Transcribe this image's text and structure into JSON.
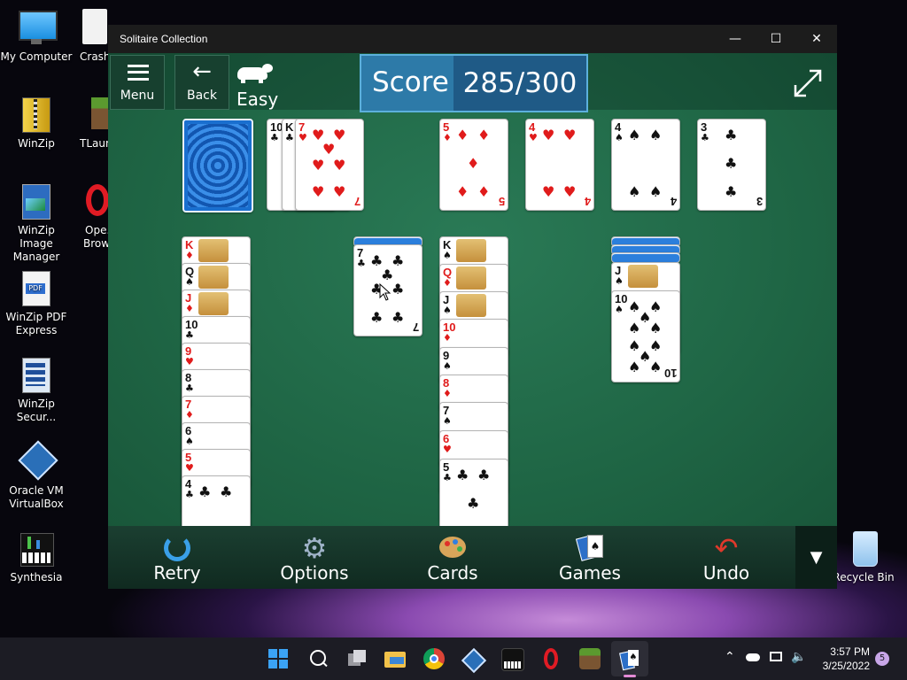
{
  "desktop": {
    "icons": [
      {
        "label": "My Computer"
      },
      {
        "label": "Crash..."
      },
      {
        "label": "WinZip"
      },
      {
        "label": "TLaun..."
      },
      {
        "label": "WinZip Image Manager"
      },
      {
        "label": "Ope... Brow..."
      },
      {
        "label": "WinZip PDF Express"
      },
      {
        "label": "WinZip Secur..."
      },
      {
        "label": "Oracle VM VirtualBox"
      },
      {
        "label": "Synthesia"
      },
      {
        "label": "Recycle Bin"
      }
    ]
  },
  "window": {
    "title": "Solitaire Collection",
    "minimize": "—",
    "maximize": "☐",
    "close": "✕"
  },
  "toolbar": {
    "menu_label": "Menu",
    "back_label": "Back",
    "difficulty": "Easy",
    "score_label": "Score",
    "score_value": "285/300"
  },
  "cards": {
    "waste": [
      {
        "rank": "10",
        "suit": "♣"
      },
      {
        "rank": "K",
        "suit": "♣"
      },
      {
        "rank": "7",
        "suit": "♥"
      }
    ],
    "foundations": [
      {
        "rank": "5",
        "suit": "♦"
      },
      {
        "rank": "4",
        "suit": "♥"
      },
      {
        "rank": "4",
        "suit": "♠"
      },
      {
        "rank": "3",
        "suit": "♣"
      }
    ],
    "col1": [
      {
        "rank": "K",
        "suit": "♦"
      },
      {
        "rank": "Q",
        "suit": "♠"
      },
      {
        "rank": "J",
        "suit": "♦"
      },
      {
        "rank": "10",
        "suit": "♣"
      },
      {
        "rank": "9",
        "suit": "♥"
      },
      {
        "rank": "8",
        "suit": "♣"
      },
      {
        "rank": "7",
        "suit": "♦"
      },
      {
        "rank": "6",
        "suit": "♠"
      },
      {
        "rank": "5",
        "suit": "♥"
      },
      {
        "rank": "4",
        "suit": "♣"
      }
    ],
    "col3": [
      {
        "rank": "7",
        "suit": "♣"
      }
    ],
    "col4": [
      {
        "rank": "K",
        "suit": "♠"
      },
      {
        "rank": "Q",
        "suit": "♦"
      },
      {
        "rank": "J",
        "suit": "♠"
      },
      {
        "rank": "10",
        "suit": "♦"
      },
      {
        "rank": "9",
        "suit": "♠"
      },
      {
        "rank": "8",
        "suit": "♦"
      },
      {
        "rank": "7",
        "suit": "♠"
      },
      {
        "rank": "6",
        "suit": "♥"
      },
      {
        "rank": "5",
        "suit": "♣"
      }
    ],
    "col6": [
      {
        "rank": "J",
        "suit": "♠"
      },
      {
        "rank": "10",
        "suit": "♠"
      }
    ]
  },
  "bottombar": {
    "retry": "Retry",
    "options": "Options",
    "cards": "Cards",
    "games": "Games",
    "undo": "Undo"
  },
  "taskbar": {
    "time": "3:57 PM",
    "date": "3/25/2022",
    "notifications": "5"
  },
  "colors": {
    "felt": "#1f6645",
    "score_bg": "#2d7aa8",
    "red_suit": "#e01b1b"
  }
}
